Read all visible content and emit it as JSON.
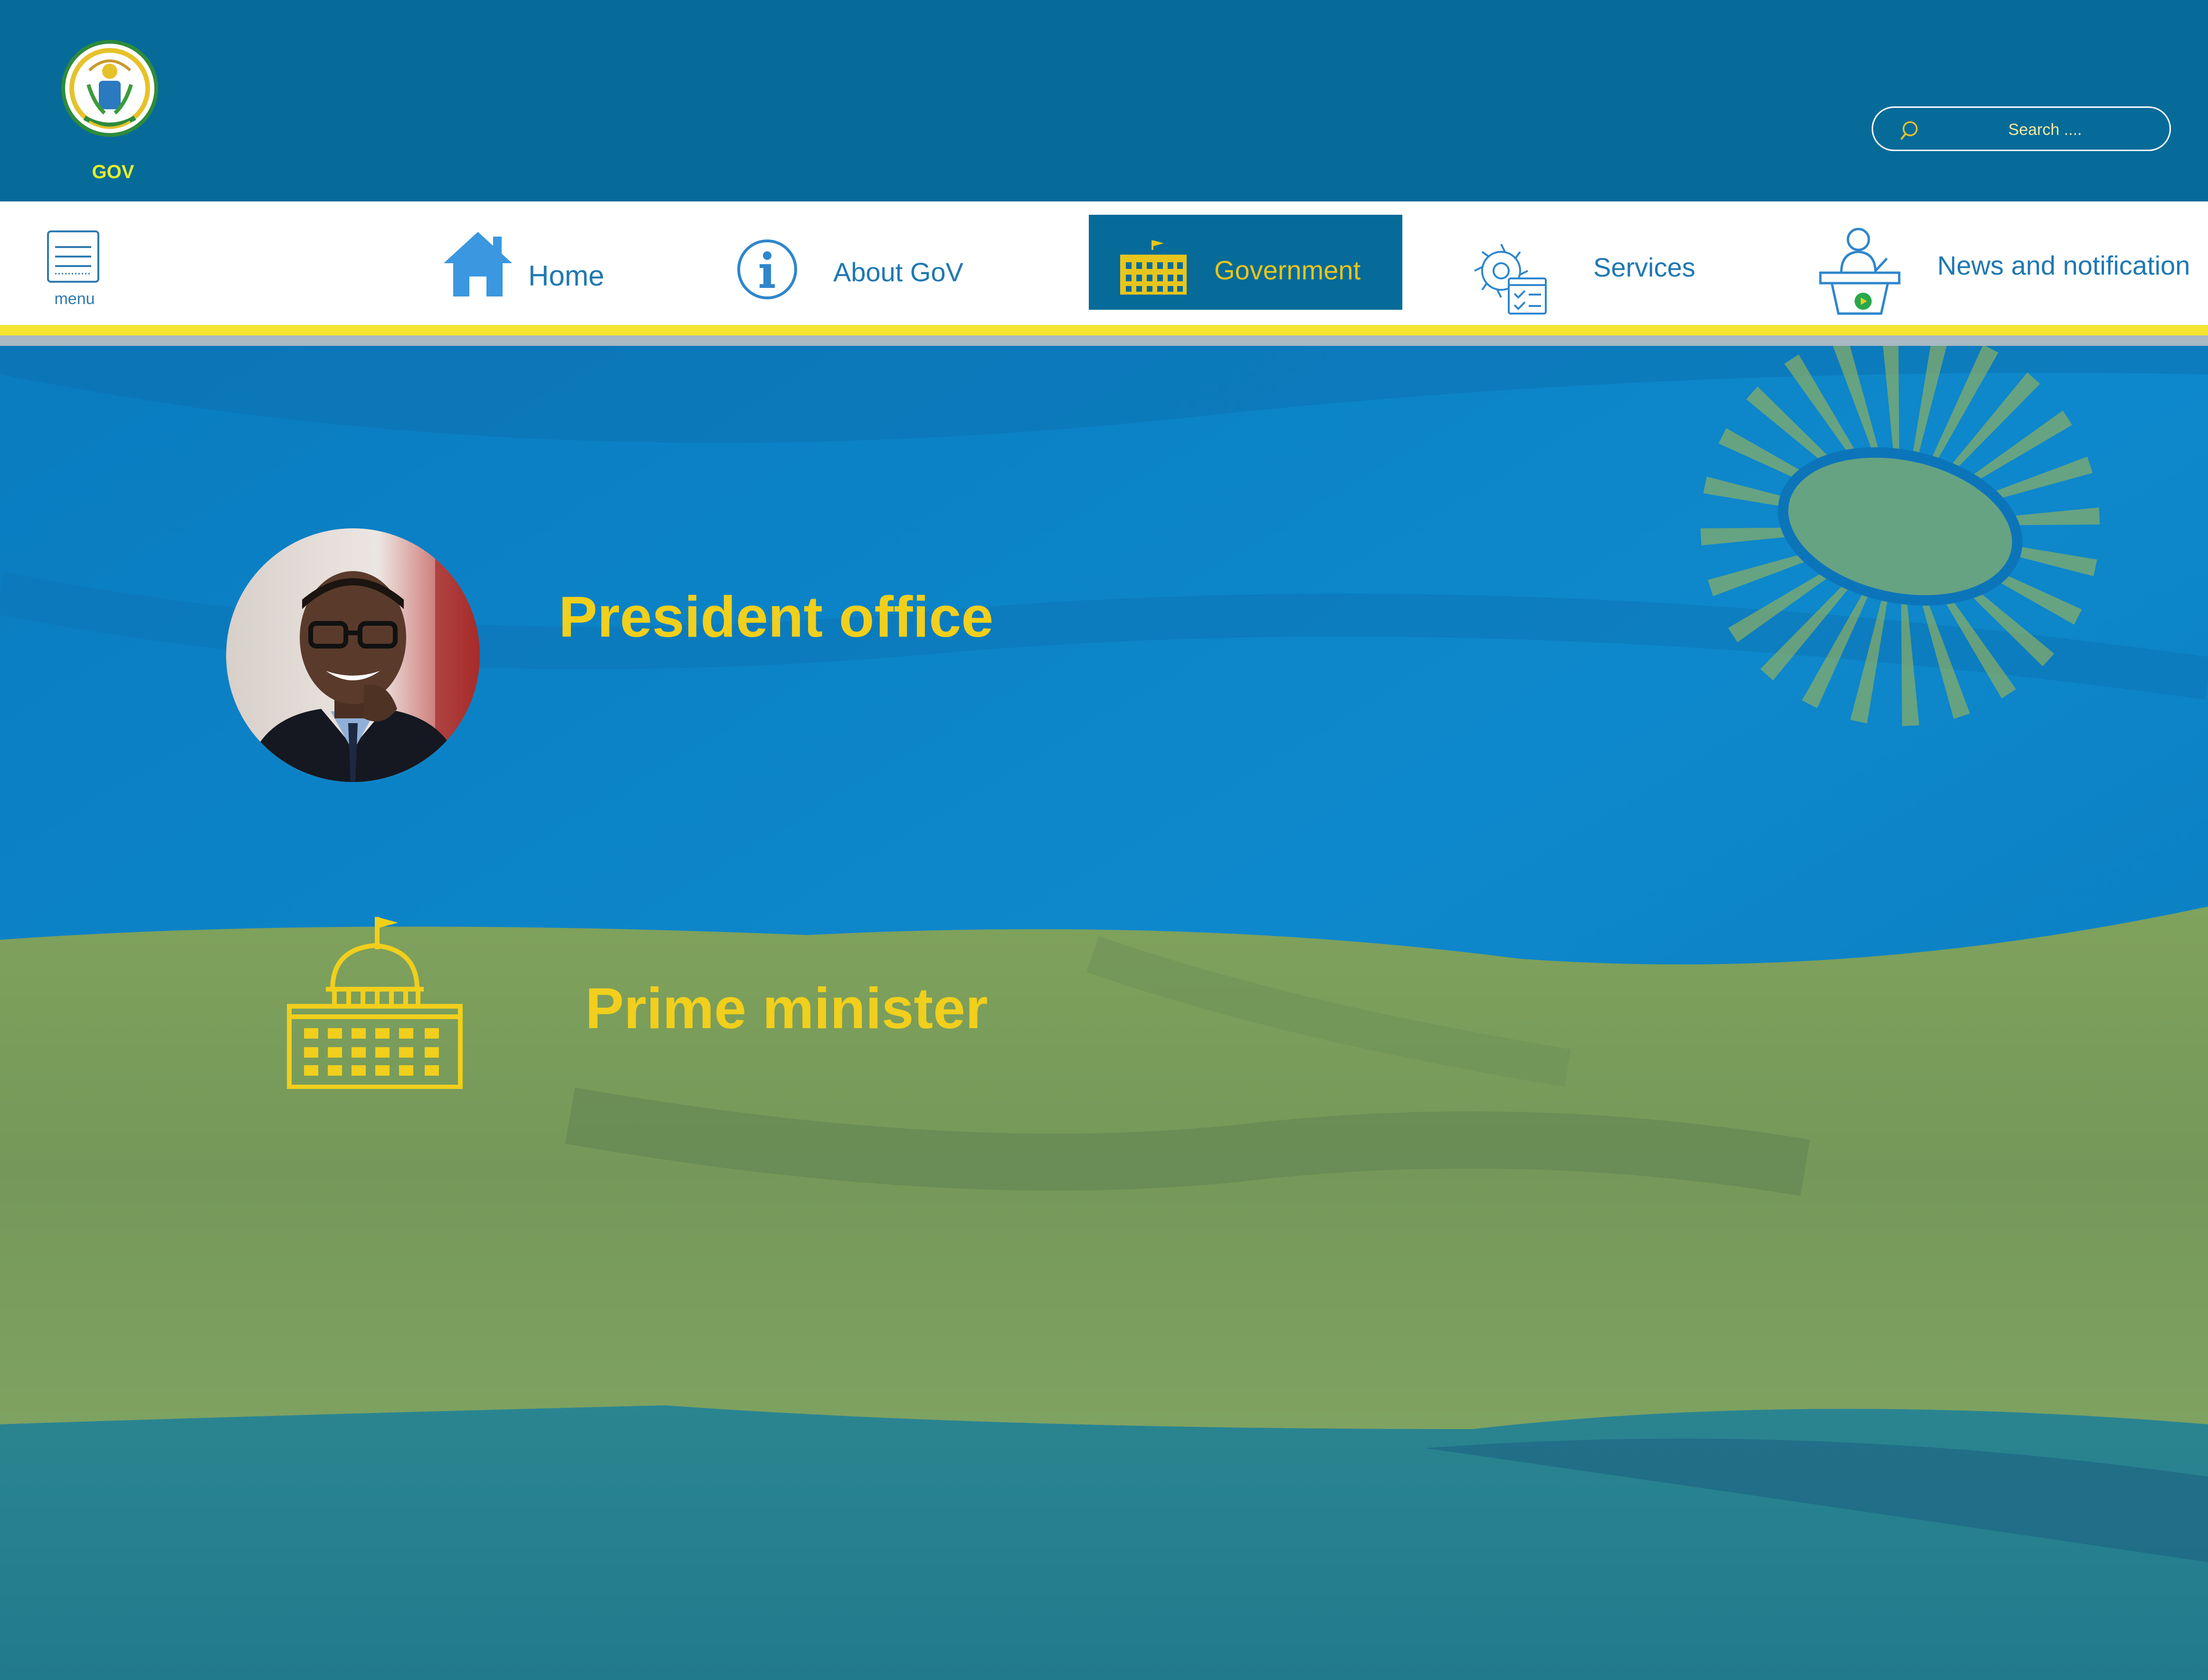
{
  "header": {
    "logo_text": "GOV",
    "search": {
      "placeholder": "Search ....",
      "value": ""
    }
  },
  "navbar": {
    "menu_label": "menu",
    "items": [
      {
        "label": "Home",
        "icon": "home-icon",
        "active": false
      },
      {
        "label": "About GoV",
        "icon": "info-icon",
        "active": false
      },
      {
        "label": "Government",
        "icon": "government-building-icon",
        "active": true
      },
      {
        "label": "Services",
        "icon": "gear-checklist-icon",
        "active": false
      },
      {
        "label": "News and notification",
        "icon": "podium-speaker-icon",
        "active": false
      }
    ]
  },
  "main": {
    "cards": [
      {
        "label": "President office",
        "image": "president-portrait"
      },
      {
        "label": "Prime minister",
        "icon": "capitol-building-icon"
      }
    ]
  },
  "colors": {
    "header_bg": "#066b99",
    "accent_yellow": "#f1cf1c",
    "flag_blue": "#0c86c7",
    "flag_green": "#7a9e5a",
    "flag_yellow": "#e6d02a",
    "nav_text": "#1f78b2"
  }
}
